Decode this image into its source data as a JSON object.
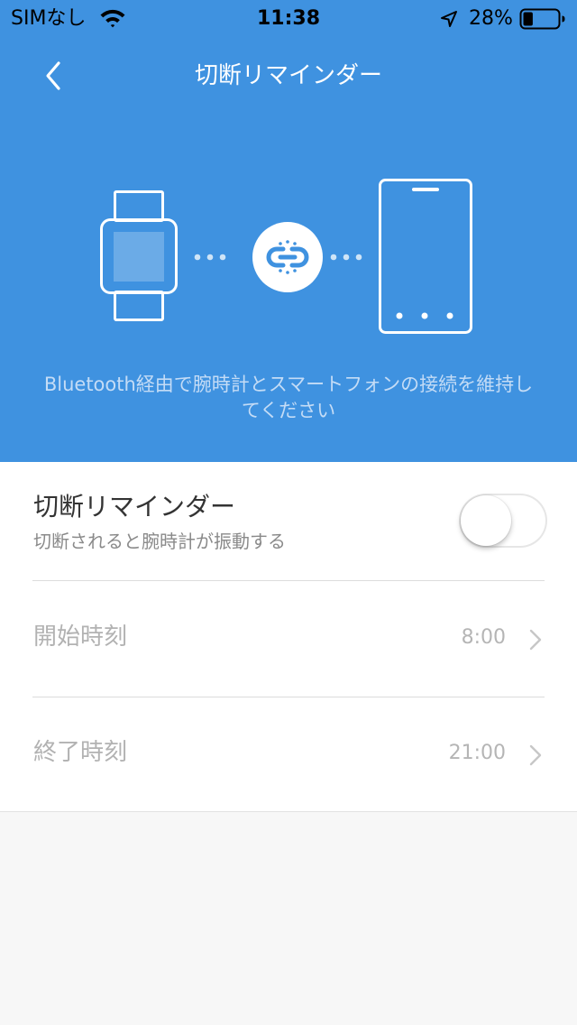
{
  "status_bar": {
    "carrier": "SIMなし",
    "time": "11:38",
    "battery_percent": "28%",
    "battery_level": 0.28
  },
  "nav": {
    "title": "切断リマインダー",
    "back_icon": "chevron-left-icon"
  },
  "illustration": {
    "watch_icon": "smartwatch-icon",
    "link_icon": "broken-link-icon",
    "phone_icon": "smartphone-icon"
  },
  "hero": {
    "description": "Bluetooth経由で腕時計とスマートフォンの接続を維持してください"
  },
  "settings": {
    "disconnect_reminder": {
      "title": "切断リマインダー",
      "subtitle": "切断されると腕時計が振動する",
      "enabled": false
    },
    "start_time": {
      "label": "開始時刻",
      "value": "8:00"
    },
    "end_time": {
      "label": "終了時刻",
      "value": "21:00"
    }
  },
  "colors": {
    "header_blue": "#3f92e0",
    "background": "#f7f7f7",
    "card": "#ffffff"
  }
}
